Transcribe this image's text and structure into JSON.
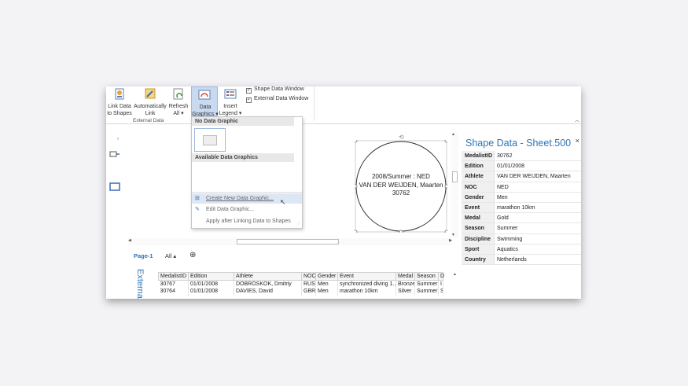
{
  "ribbon": {
    "buttons": [
      {
        "label": "Link Data to Shapes"
      },
      {
        "label": "Automatically Link"
      },
      {
        "label": "Refresh All ▾"
      },
      {
        "label": "Data Graphics ▾"
      },
      {
        "label": "Insert Legend ▾"
      }
    ],
    "group_label": "External Data",
    "checkboxes": [
      {
        "label": "Shape Data Window",
        "checked": "✓"
      },
      {
        "label": "External Data Window",
        "checked": "✓"
      }
    ],
    "collapse_icon": "chevron-up-icon"
  },
  "menu": {
    "no_data_header": "No Data Graphic",
    "available_header": "Available Data Graphics",
    "items": [
      {
        "label": "Create New Data Graphic..."
      },
      {
        "label": "Edit Data Graphic..."
      },
      {
        "label": "Apply after Linking Data to Shapes"
      }
    ]
  },
  "shape": {
    "line1": "2008/Summer : NED",
    "line2": "VAN DER WEIJDEN, Maarten",
    "line3": "30762"
  },
  "shape_data": {
    "title": "Shape Data - Sheet.500",
    "close": "×",
    "rows": [
      {
        "k": "MedalistID",
        "v": "30762"
      },
      {
        "k": "Edition",
        "v": "01/01/2008"
      },
      {
        "k": "Athlete",
        "v": "VAN DER WEIJDEN, Maarten"
      },
      {
        "k": "NOC",
        "v": "NED"
      },
      {
        "k": "Gender",
        "v": "Men"
      },
      {
        "k": "Event",
        "v": "marathon 10km"
      },
      {
        "k": "Medal",
        "v": "Gold"
      },
      {
        "k": "Season",
        "v": "Summer"
      },
      {
        "k": "Discipline",
        "v": "Swimming"
      },
      {
        "k": "Sport",
        "v": "Aquatics"
      },
      {
        "k": "Country",
        "v": "Netherlands"
      }
    ]
  },
  "tabs": {
    "page": "Page-1",
    "all": "All ▴",
    "add": "⊕"
  },
  "external_data": {
    "side_label": "Externa",
    "headers": [
      "MedalistID",
      "Edition",
      "Athlete",
      "NOC",
      "Gender",
      "Event",
      "Medal",
      "Season",
      "D"
    ],
    "rows": [
      [
        "30767",
        "01/01/2008",
        "DOBROSKOK, Dmitriy",
        "RUS",
        "Men",
        "synchronized diving 1...",
        "Bronze",
        "Summer",
        "I"
      ],
      [
        "30764",
        "01/01/2008",
        "DAVIES, David",
        "GBR",
        "Men",
        "marathon 10km",
        "Silver",
        "Summer",
        "S"
      ]
    ]
  },
  "colors": {
    "accent": "#2e75b6",
    "highlight": "#dde6f5"
  }
}
